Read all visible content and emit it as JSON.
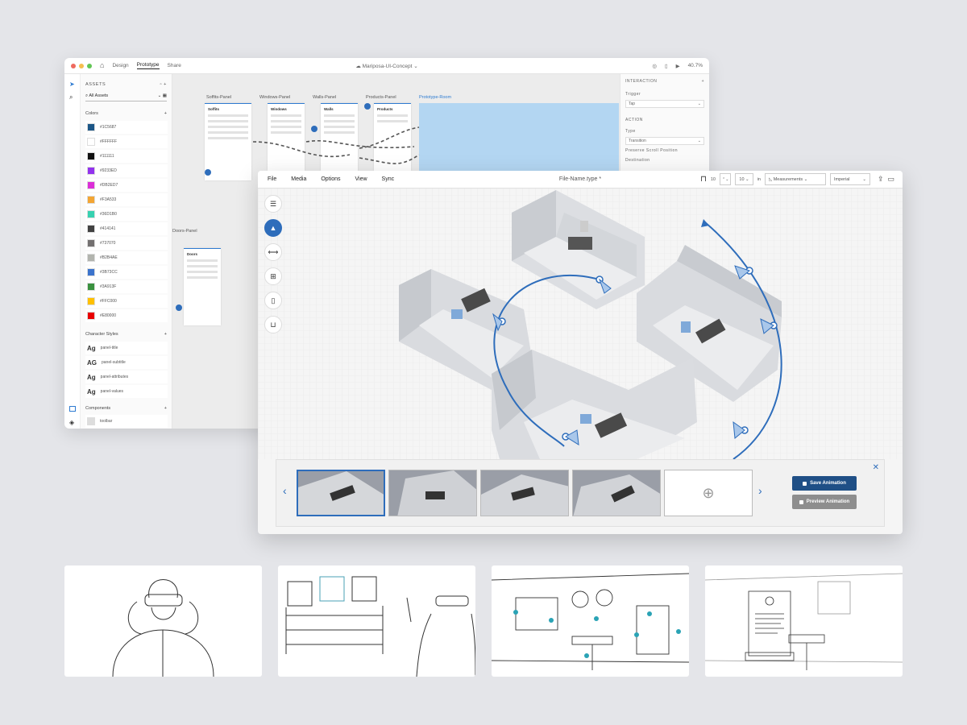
{
  "xd": {
    "tabs": [
      "Design",
      "Prototype",
      "Share"
    ],
    "doc_title": "Mariposa-UI-Concept",
    "zoom": "40.7%",
    "assets_title": "ASSETS",
    "search_label": "All Assets",
    "colors_label": "Colors",
    "colors": [
      {
        "hex": "#1C5687"
      },
      {
        "hex": "#FFFFFF"
      },
      {
        "hex": "#111111"
      },
      {
        "hex": "#9233ED"
      },
      {
        "hex": "#DB2ED7"
      },
      {
        "hex": "#F3A533"
      },
      {
        "hex": "#36D1B0"
      },
      {
        "hex": "#414141"
      },
      {
        "hex": "#737070"
      },
      {
        "hex": "#B2B4AE"
      },
      {
        "hex": "#3B73CC"
      },
      {
        "hex": "#3A913F"
      },
      {
        "hex": "#FFC000"
      },
      {
        "hex": "#E80000"
      }
    ],
    "char_styles_label": "Character Styles",
    "char_styles": [
      {
        "glyph": "Ag",
        "name": "panel-title"
      },
      {
        "glyph": "AG",
        "name": "panel-subtitle"
      },
      {
        "glyph": "Ag",
        "name": "panel-attributes"
      },
      {
        "glyph": "Ag",
        "name": "panel-values"
      }
    ],
    "components_label": "Components",
    "components": [
      "toolbar"
    ],
    "artboards": [
      {
        "label": "Soffits-Panel",
        "title": "Soffits"
      },
      {
        "label": "Windows-Panel",
        "title": "Windows"
      },
      {
        "label": "Walls-Panel",
        "title": "Walls"
      },
      {
        "label": "Products-Panel",
        "title": "Products"
      },
      {
        "label": "Prototype-Room",
        "title": ""
      }
    ],
    "doors": {
      "label": "Doors-Panel",
      "title": "Doors"
    },
    "inspector": {
      "interaction": "INTERACTION",
      "trigger_label": "Trigger",
      "trigger_value": "Tap",
      "action": "ACTION",
      "type_label": "Type",
      "type_value": "Transition",
      "reserve": "Preserve Scroll Position",
      "destination": "Destination"
    }
  },
  "editor": {
    "menu": [
      "File",
      "Media",
      "Options",
      "View",
      "Sync"
    ],
    "file_name": "File-Name.type *",
    "height_value": "10",
    "height_value_2": "10",
    "unit": "in",
    "measurements": "Measurements",
    "units_system": "Imperial",
    "save_label": "Save Animation",
    "preview_label": "Preview Animation",
    "accent": "#2E6DBB"
  }
}
